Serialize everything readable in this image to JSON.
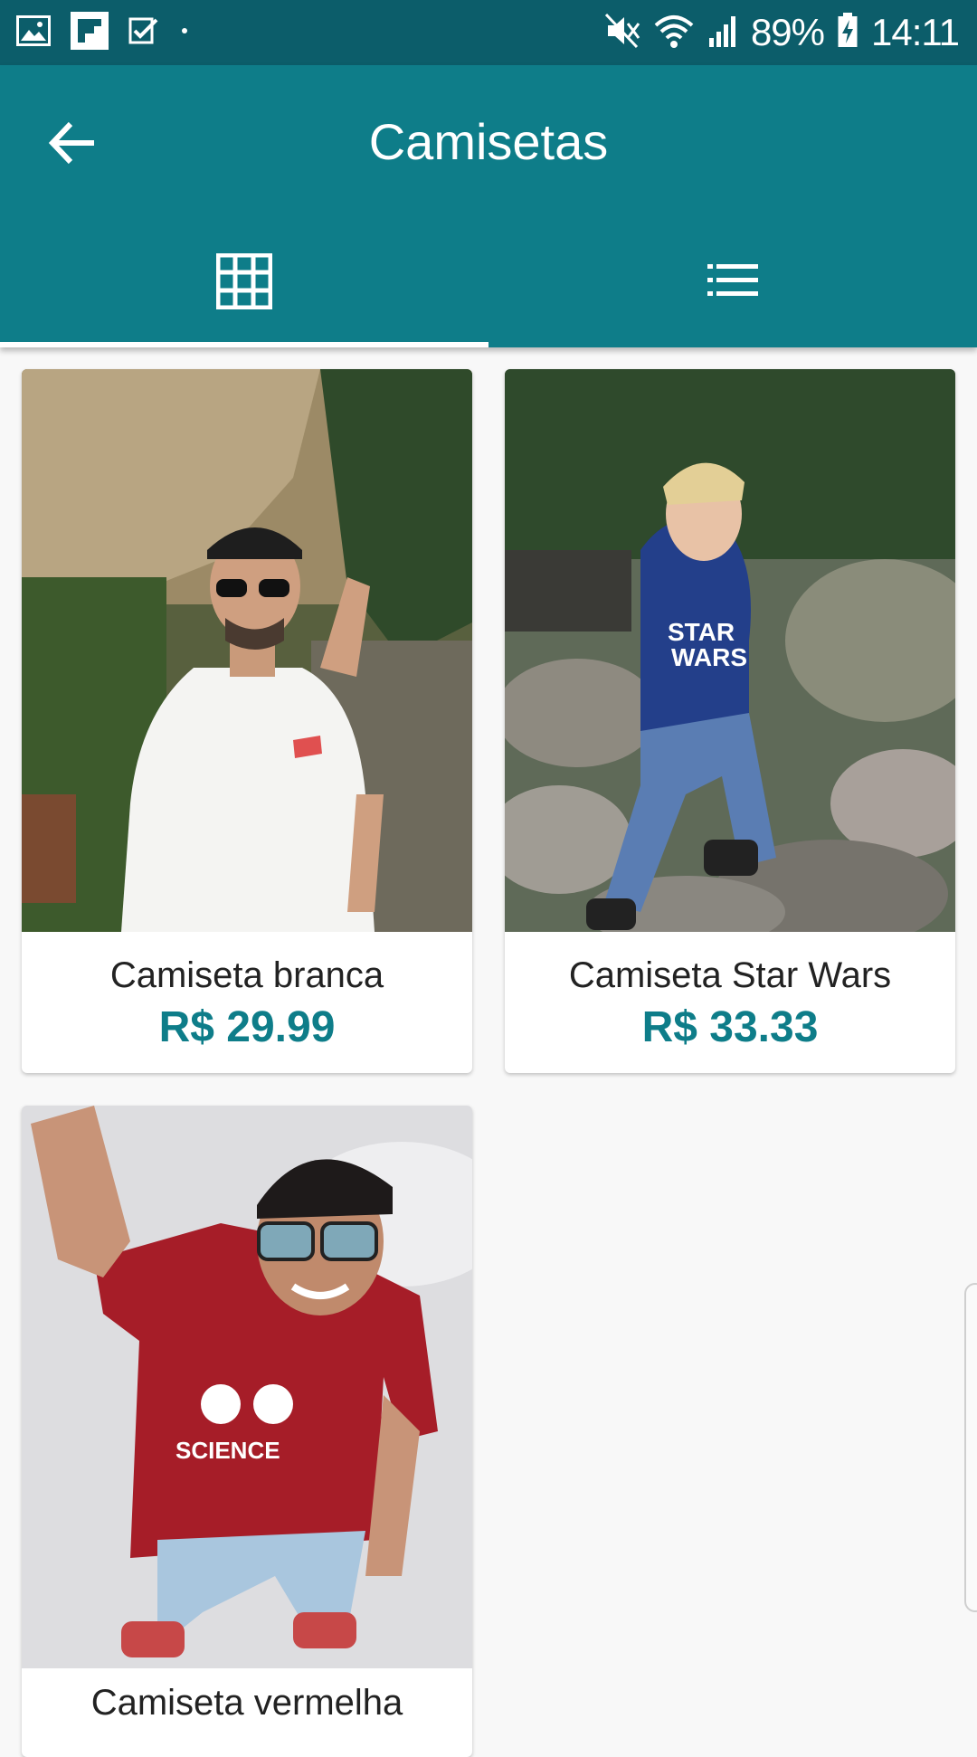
{
  "status_bar": {
    "battery": "89%",
    "time": "14:11",
    "icons": [
      "gallery-icon",
      "flipboard-icon",
      "check-notification-icon",
      "dot-icon",
      "mute-icon",
      "wifi-icon",
      "signal-icon",
      "battery-charging-icon"
    ]
  },
  "app_bar": {
    "title": "Camisetas",
    "back_icon": "arrow-left-icon",
    "tabs": [
      {
        "icon": "grid-icon",
        "selected": true
      },
      {
        "icon": "list-icon",
        "selected": false
      }
    ]
  },
  "products": [
    {
      "name": "Camiseta branca",
      "price": "R$ 29.99"
    },
    {
      "name": "Camiseta Star Wars",
      "price": "R$ 33.33"
    },
    {
      "name": "Camiseta vermelha",
      "price": ""
    }
  ],
  "colors": {
    "status_bar": "#0c5d6a",
    "app_bar": "#0e7d89",
    "accent": "#0e7d89",
    "background": "#f8f8f8"
  }
}
